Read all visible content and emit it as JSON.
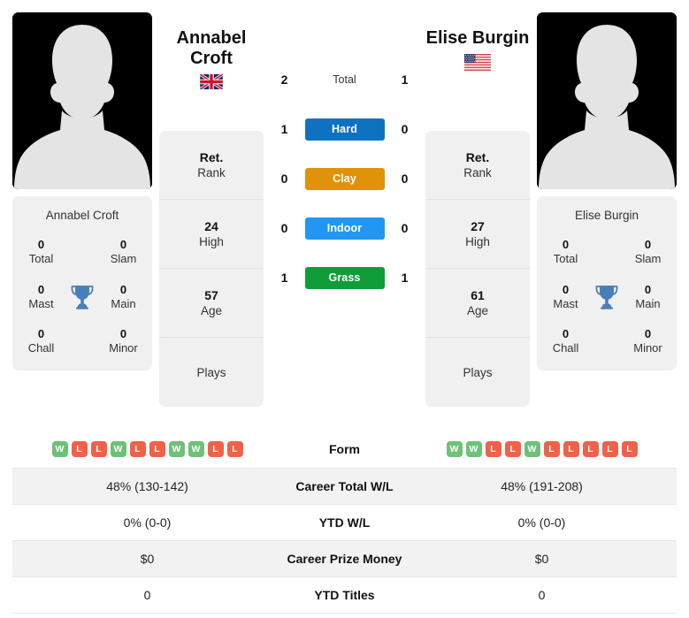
{
  "players": {
    "left": {
      "name": "Annabel Croft",
      "name_line1": "Annabel",
      "name_line2": "Croft",
      "flag": "gb-flag-icon",
      "flag_alt": "Great Britain flag",
      "avatar": "player-silhouette",
      "rank": {
        "value": "Ret.",
        "label": "Rank"
      },
      "high": {
        "value": "24",
        "label": "High"
      },
      "age": {
        "value": "57",
        "label": "Age"
      },
      "plays": {
        "value": "",
        "label": "Plays"
      },
      "titles": [
        {
          "num": "0",
          "label": "Total"
        },
        {
          "num": "0",
          "label": "Slam"
        },
        {
          "num": "0",
          "label": "Mast"
        },
        {
          "num": "0",
          "label": "Main"
        },
        {
          "num": "0",
          "label": "Chall"
        },
        {
          "num": "0",
          "label": "Minor"
        }
      ],
      "form": [
        "W",
        "L",
        "L",
        "W",
        "L",
        "L",
        "W",
        "W",
        "L",
        "L"
      ],
      "career_total_wl": "48% (130-142)",
      "ytd_wl": "0% (0-0)",
      "career_prize_money": "$0",
      "ytd_titles": "0"
    },
    "right": {
      "name": "Elise Burgin",
      "name_line1": "Elise Burgin",
      "name_line2": "",
      "flag": "us-flag-icon",
      "flag_alt": "United States flag",
      "avatar": "player-silhouette",
      "rank": {
        "value": "Ret.",
        "label": "Rank"
      },
      "high": {
        "value": "27",
        "label": "High"
      },
      "age": {
        "value": "61",
        "label": "Age"
      },
      "plays": {
        "value": "",
        "label": "Plays"
      },
      "titles": [
        {
          "num": "0",
          "label": "Total"
        },
        {
          "num": "0",
          "label": "Slam"
        },
        {
          "num": "0",
          "label": "Mast"
        },
        {
          "num": "0",
          "label": "Main"
        },
        {
          "num": "0",
          "label": "Chall"
        },
        {
          "num": "0",
          "label": "Minor"
        }
      ],
      "form": [
        "W",
        "W",
        "L",
        "L",
        "W",
        "L",
        "L",
        "L",
        "L",
        "L"
      ],
      "career_total_wl": "48% (191-208)",
      "ytd_wl": "0% (0-0)",
      "career_prize_money": "$0",
      "ytd_titles": "0"
    }
  },
  "h2h": {
    "total": {
      "label": "Total",
      "left": "2",
      "right": "1"
    },
    "surfaces": [
      {
        "label": "Hard",
        "left": "1",
        "right": "0",
        "color": "#0e72c0"
      },
      {
        "label": "Clay",
        "left": "0",
        "right": "0",
        "color": "#e09208"
      },
      {
        "label": "Indoor",
        "left": "0",
        "right": "0",
        "color": "#2196f3"
      },
      {
        "label": "Grass",
        "left": "1",
        "right": "1",
        "color": "#0f9d3a"
      }
    ]
  },
  "table": {
    "rows": [
      {
        "label": "Form",
        "key": "form"
      },
      {
        "label": "Career Total W/L",
        "key": "career_total_wl"
      },
      {
        "label": "YTD W/L",
        "key": "ytd_wl"
      },
      {
        "label": "Career Prize Money",
        "key": "career_prize_money"
      },
      {
        "label": "YTD Titles",
        "key": "ytd_titles"
      }
    ]
  },
  "colors": {
    "win_badge": "#6ec177",
    "loss_badge": "#f0614a",
    "panel": "#f0f0f0",
    "row_alt": "#f2f2f2"
  }
}
